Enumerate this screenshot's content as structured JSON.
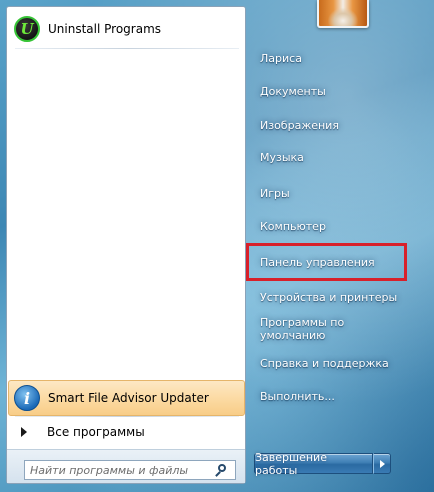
{
  "pinned": [
    {
      "label": "Uninstall Programs",
      "icon": "iobit-uninstaller-icon"
    }
  ],
  "recent": [
    {
      "label": "Smart File Advisor Updater",
      "icon": "info-icon"
    }
  ],
  "all_programs": {
    "label": "Все программы"
  },
  "search": {
    "placeholder": "Найти программы и файлы",
    "value": ""
  },
  "right_menu": {
    "items": [
      "Лариса",
      "Документы",
      "Изображения",
      "Музыка",
      "Игры",
      "Компьютер",
      "Панель управления",
      "Устройства и принтеры",
      "Программы по умолчанию",
      "Справка и поддержка",
      "Выполнить..."
    ],
    "highlighted_item": "Панель управления",
    "highlight_color": "#d8202a"
  },
  "shutdown": {
    "label": "Завершение работы"
  },
  "icons": {
    "iobit_letter": "U",
    "info_letter": "i"
  },
  "colors": {
    "recent_highlight": "#fbd89e",
    "accent_blue": "#2a6aa2",
    "iobit_green": "#37c437"
  }
}
